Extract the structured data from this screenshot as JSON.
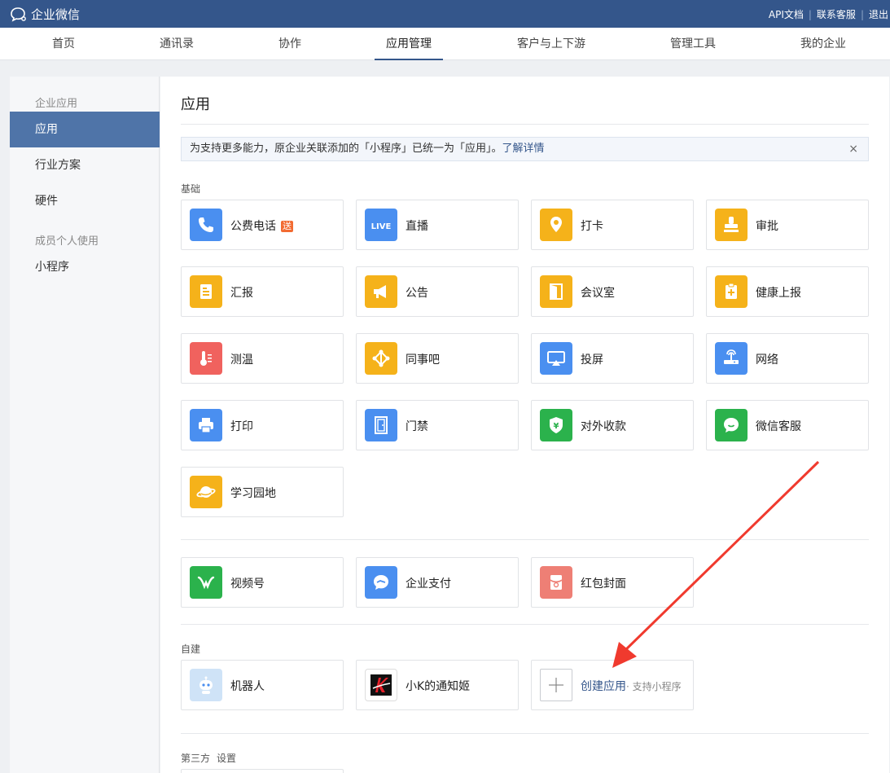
{
  "header": {
    "app_name": "企业微信",
    "links": [
      "API文档",
      "联系客服",
      "退出"
    ]
  },
  "nav": {
    "tabs": [
      "首页",
      "通讯录",
      "协作",
      "应用管理",
      "客户与上下游",
      "管理工具",
      "我的企业"
    ],
    "active": "应用管理"
  },
  "sidebar": {
    "section1": "企业应用",
    "items1": [
      "应用",
      "行业方案",
      "硬件"
    ],
    "section2": "成员个人使用",
    "items2": [
      "小程序"
    ],
    "active": "应用"
  },
  "main": {
    "title": "应用",
    "notice": {
      "text": "为支持更多能力，原企业关联添加的「小程序」已统一为「应用」。",
      "link": "了解详情",
      "close": "×"
    },
    "basic_label": "基础",
    "basic_apps": [
      {
        "name": "公费电话",
        "icon": "phone-icon",
        "color": "#4a8ff0",
        "badge": "送"
      },
      {
        "name": "直播",
        "icon": "live-icon",
        "color": "#4a8ff0"
      },
      {
        "name": "打卡",
        "icon": "location-pin-icon",
        "color": "#f5b21a"
      },
      {
        "name": "审批",
        "icon": "stamp-icon",
        "color": "#f5b21a"
      },
      {
        "name": "汇报",
        "icon": "report-icon",
        "color": "#f5b21a"
      },
      {
        "name": "公告",
        "icon": "megaphone-icon",
        "color": "#f5b21a"
      },
      {
        "name": "会议室",
        "icon": "door-icon",
        "color": "#f5b21a"
      },
      {
        "name": "健康上报",
        "icon": "health-clipboard-icon",
        "color": "#f5b21a"
      },
      {
        "name": "测温",
        "icon": "thermometer-icon",
        "color": "#f0625e"
      },
      {
        "name": "同事吧",
        "icon": "network-nodes-icon",
        "color": "#f5b21a"
      },
      {
        "name": "投屏",
        "icon": "screencast-icon",
        "color": "#4a8ff0"
      },
      {
        "name": "网络",
        "icon": "router-icon",
        "color": "#4a8ff0"
      },
      {
        "name": "打印",
        "icon": "printer-icon",
        "color": "#4a8ff0"
      },
      {
        "name": "门禁",
        "icon": "access-door-icon",
        "color": "#4a8ff0"
      },
      {
        "name": "对外收款",
        "icon": "yuan-shield-icon",
        "color": "#2bb24c"
      },
      {
        "name": "微信客服",
        "icon": "chat-bubble-icon",
        "color": "#2bb24c"
      },
      {
        "name": "学习园地",
        "icon": "planet-icon",
        "color": "#f5b21a"
      }
    ],
    "extra_apps": [
      {
        "name": "视频号",
        "icon": "channels-icon",
        "color": "#2bb24c"
      },
      {
        "name": "企业支付",
        "icon": "pay-icon",
        "color": "#4a8ff0"
      },
      {
        "name": "红包封面",
        "icon": "red-packet-icon",
        "color": "#ee7f75"
      }
    ],
    "custom_label": "自建",
    "custom_apps": [
      {
        "name": "机器人",
        "icon": "robot-icon"
      },
      {
        "name": "小K的通知姬",
        "icon": "k-logo-icon"
      }
    ],
    "create": {
      "label": "创建应用",
      "sub": "· 支持小程序"
    },
    "third_party_label": "第三方",
    "third_party_settings": "设置"
  }
}
